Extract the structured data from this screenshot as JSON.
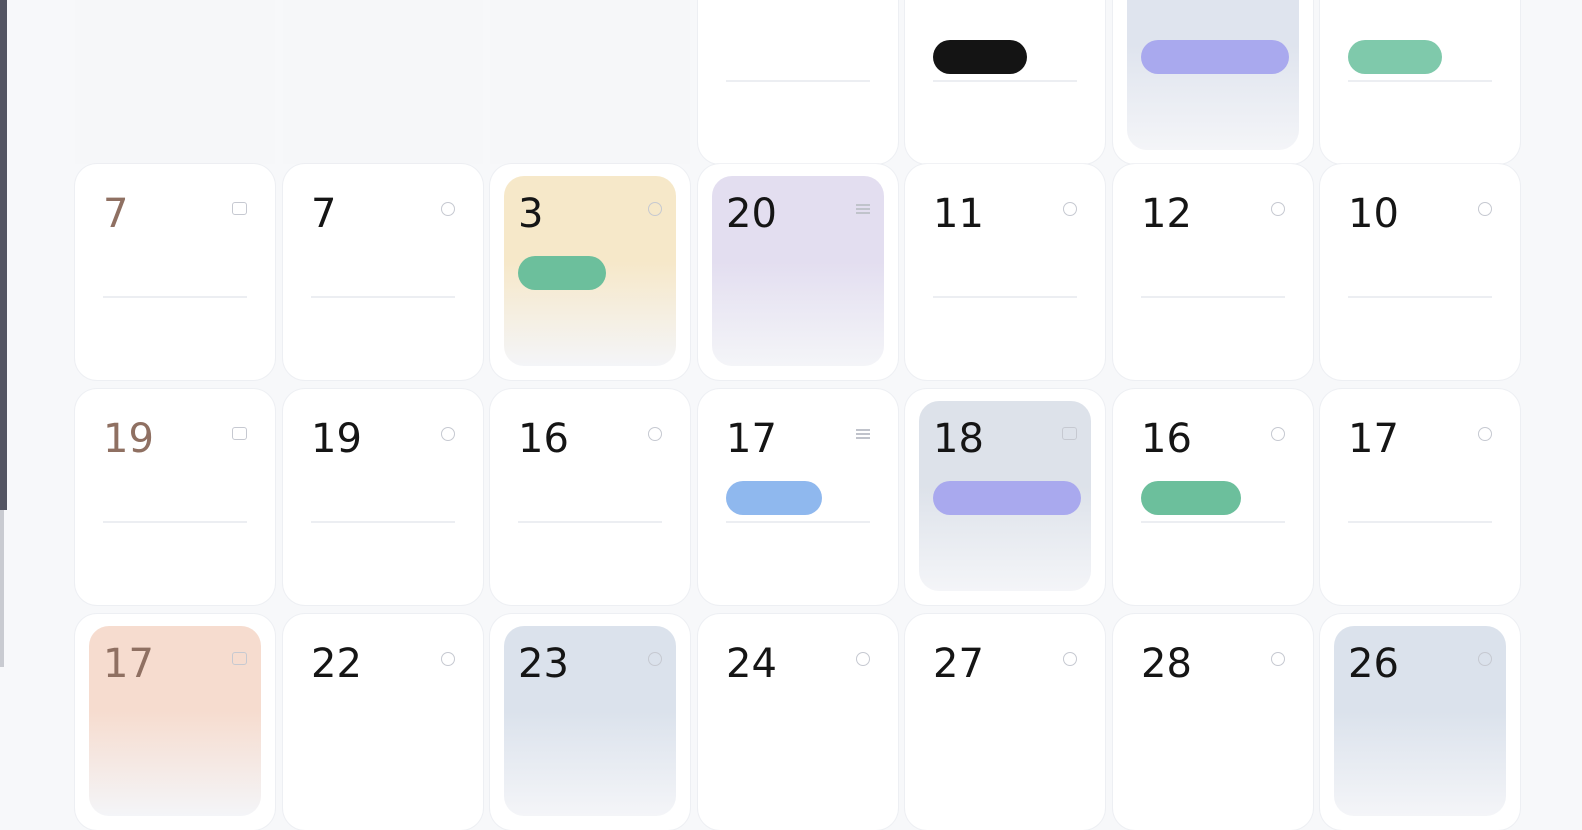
{
  "calendar": {
    "rows": [
      [
        {
          "day": "",
          "empty": true
        },
        {
          "day": "",
          "empty": true
        },
        {
          "day": "",
          "empty": true
        },
        {
          "day": "",
          "note": "",
          "icon": "none-icon"
        },
        {
          "day": "",
          "tag": {
            "label": "",
            "color": "#141414"
          },
          "icon": "none-icon"
        },
        {
          "day": "",
          "highlight": "#dfe4ee",
          "tag": {
            "label": "",
            "color": "#a9a9ee"
          },
          "icon": "none-icon"
        },
        {
          "day": "",
          "tag": {
            "label": "",
            "color": "#7fc9ab"
          },
          "icon": "none-icon"
        }
      ],
      [
        {
          "day": "7",
          "faded": true,
          "note": "",
          "icon": "square-icon"
        },
        {
          "day": "7",
          "mark": "",
          "note": "",
          "icon": "info-circle-icon"
        },
        {
          "day": "3",
          "highlight": "#f6e8c9",
          "tag": {
            "label": "",
            "color": "#6cbf9c"
          },
          "icon": "info-circle-icon"
        },
        {
          "day": "20",
          "highlight": "#e3def0",
          "note": "",
          "icon": "menu-lines-icon"
        },
        {
          "day": "11",
          "note": "",
          "icon": "info-circle-icon"
        },
        {
          "day": "12",
          "note": "",
          "icon": "info-circle-icon"
        },
        {
          "day": "10",
          "note": "",
          "icon": "info-circle-icon"
        }
      ],
      [
        {
          "day": "19",
          "faded": true,
          "note": "",
          "icon": "square-icon"
        },
        {
          "day": "19",
          "note": "",
          "icon": "info-circle-icon"
        },
        {
          "day": "16",
          "note": "",
          "icon": "info-circle-icon"
        },
        {
          "day": "17",
          "tag": {
            "label": "",
            "color": "#8fb8ee"
          },
          "icon": "menu-lines-icon"
        },
        {
          "day": "18",
          "highlight": "#dde2ea",
          "tag": {
            "label": "",
            "color": "#a9a9ee"
          },
          "icon": "square-icon"
        },
        {
          "day": "16",
          "tag": {
            "label": "",
            "color": "#6cbf9c"
          },
          "icon": "info-circle-icon"
        },
        {
          "day": "17",
          "note": "",
          "icon": "info-circle-icon"
        }
      ],
      [
        {
          "day": "17",
          "faded": true,
          "highlight": "#f6dccf",
          "icon": "square-icon"
        },
        {
          "day": "22",
          "icon": "info-circle-icon"
        },
        {
          "day": "23",
          "highlight": "#dbe2ec",
          "icon": "info-circle-icon"
        },
        {
          "day": "24",
          "icon": "info-circle-icon"
        },
        {
          "day": "27",
          "icon": "info-circle-icon"
        },
        {
          "day": "28",
          "icon": "info-circle-icon"
        },
        {
          "day": "26",
          "highlight": "#dbe2ec",
          "icon": "info-circle-icon"
        }
      ]
    ]
  }
}
